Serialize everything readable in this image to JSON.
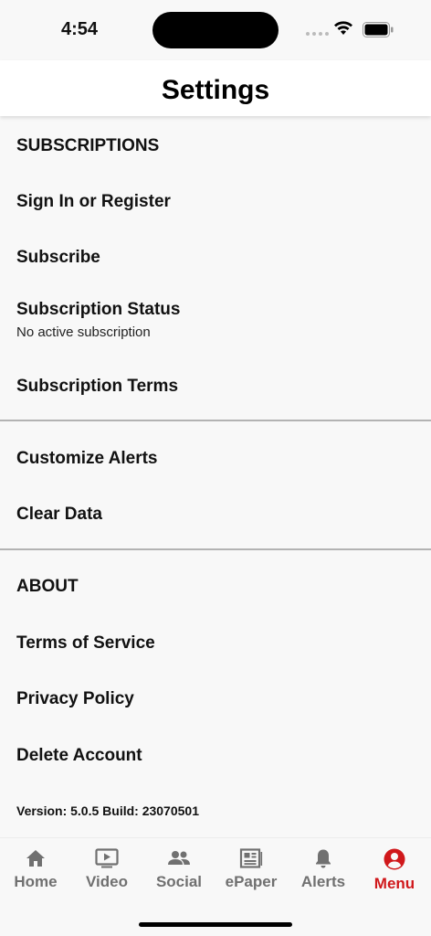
{
  "status_bar": {
    "time": "4:54"
  },
  "header": {
    "title": "Settings"
  },
  "sections": {
    "subscriptions_heading": "SUBSCRIPTIONS",
    "sign_in": "Sign In or Register",
    "subscribe": "Subscribe",
    "subscription_status": "Subscription Status",
    "subscription_status_value": "No active subscription",
    "subscription_terms": "Subscription Terms",
    "customize_alerts": "Customize Alerts",
    "clear_data": "Clear Data",
    "about_heading": "ABOUT",
    "terms_of_service": "Terms of Service",
    "privacy_policy": "Privacy Policy",
    "delete_account": "Delete Account",
    "version": "Version: 5.0.5 Build: 23070501"
  },
  "tabbar": {
    "tabs": [
      {
        "label": "Home",
        "icon": "home-icon"
      },
      {
        "label": "Video",
        "icon": "video-icon"
      },
      {
        "label": "Social",
        "icon": "people-icon"
      },
      {
        "label": "ePaper",
        "icon": "newspaper-icon"
      },
      {
        "label": "Alerts",
        "icon": "bell-icon"
      },
      {
        "label": "Menu",
        "icon": "user-circle-icon",
        "active": true
      }
    ],
    "active_color": "#d0181b",
    "inactive_color": "#707070"
  }
}
